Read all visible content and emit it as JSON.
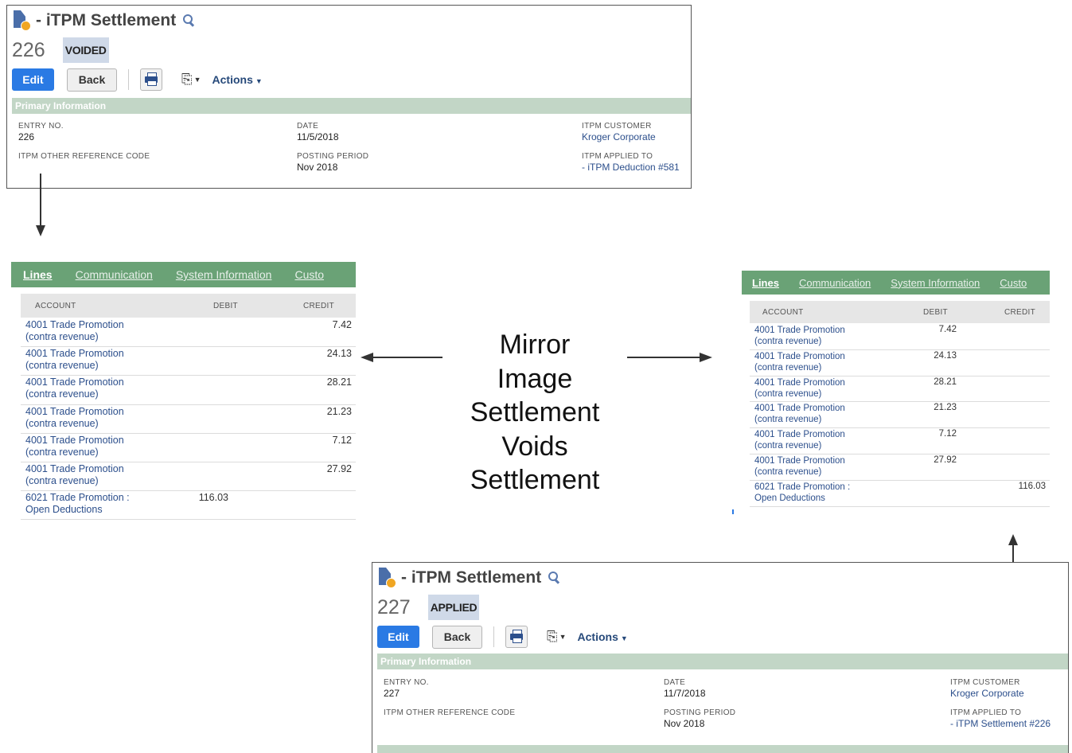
{
  "caption": [
    "Mirror",
    "Image",
    "Settlement",
    "Voids",
    "Settlement"
  ],
  "records": [
    {
      "title": "- iTPM Settlement",
      "number": "226",
      "status": "VOIDED",
      "toolbar": {
        "edit": "Edit",
        "back": "Back",
        "actions": "Actions"
      },
      "section": "Primary Information",
      "fields": {
        "entry_no_label": "ENTRY NO.",
        "entry_no": "226",
        "other_ref_label": "ITPM OTHER REFERENCE CODE",
        "date_label": "DATE",
        "date": "11/5/2018",
        "posting_period_label": "POSTING PERIOD",
        "posting_period": "Nov 2018",
        "customer_label": "ITPM CUSTOMER",
        "customer": "Kroger Corporate",
        "applied_to_label": "ITPM APPLIED TO",
        "applied_to": "- iTPM Deduction #581"
      }
    },
    {
      "title": "- iTPM Settlement",
      "number": "227",
      "status": "APPLIED",
      "toolbar": {
        "edit": "Edit",
        "back": "Back",
        "actions": "Actions"
      },
      "section": "Primary Information",
      "fields": {
        "entry_no_label": "ENTRY NO.",
        "entry_no": "227",
        "other_ref_label": "ITPM OTHER REFERENCE CODE",
        "date_label": "DATE",
        "date": "11/7/2018",
        "posting_period_label": "POSTING PERIOD",
        "posting_period": "Nov 2018",
        "customer_label": "ITPM CUSTOMER",
        "customer": "Kroger Corporate",
        "applied_to_label": "ITPM APPLIED TO",
        "applied_to": "- iTPM Settlement #226"
      }
    }
  ],
  "grids": [
    {
      "tabs": [
        "Lines",
        "Communication",
        "System Information",
        "Custo"
      ],
      "columns": [
        "ACCOUNT",
        "DEBIT",
        "CREDIT"
      ],
      "rows": [
        {
          "account": [
            "4001 Trade Promotion",
            "(contra revenue)"
          ],
          "debit": "",
          "credit": "7.42"
        },
        {
          "account": [
            "4001 Trade Promotion",
            "(contra revenue)"
          ],
          "debit": "",
          "credit": "24.13"
        },
        {
          "account": [
            "4001 Trade Promotion",
            "(contra revenue)"
          ],
          "debit": "",
          "credit": "28.21"
        },
        {
          "account": [
            "4001 Trade Promotion",
            "(contra revenue)"
          ],
          "debit": "",
          "credit": "21.23"
        },
        {
          "account": [
            "4001 Trade Promotion",
            "(contra revenue)"
          ],
          "debit": "",
          "credit": "7.12"
        },
        {
          "account": [
            "4001 Trade Promotion",
            "(contra revenue)"
          ],
          "debit": "",
          "credit": "27.92"
        },
        {
          "account": [
            "6021 Trade Promotion :",
            "Open Deductions"
          ],
          "debit": "116.03",
          "credit": ""
        }
      ]
    },
    {
      "tabs": [
        "Lines",
        "Communication",
        "System Information",
        "Custo"
      ],
      "columns": [
        "ACCOUNT",
        "DEBIT",
        "CREDIT"
      ],
      "rows": [
        {
          "account": [
            "4001 Trade Promotion",
            "(contra revenue)"
          ],
          "debit": "7.42",
          "credit": ""
        },
        {
          "account": [
            "4001 Trade Promotion",
            "(contra revenue)"
          ],
          "debit": "24.13",
          "credit": ""
        },
        {
          "account": [
            "4001 Trade Promotion",
            "(contra revenue)"
          ],
          "debit": "28.21",
          "credit": ""
        },
        {
          "account": [
            "4001 Trade Promotion",
            "(contra revenue)"
          ],
          "debit": "21.23",
          "credit": ""
        },
        {
          "account": [
            "4001 Trade Promotion",
            "(contra revenue)"
          ],
          "debit": "7.12",
          "credit": ""
        },
        {
          "account": [
            "4001 Trade Promotion",
            "(contra revenue)"
          ],
          "debit": "27.92",
          "credit": ""
        },
        {
          "account": [
            "6021 Trade Promotion :",
            "Open Deductions"
          ],
          "debit": "",
          "credit": "116.03"
        }
      ]
    }
  ]
}
